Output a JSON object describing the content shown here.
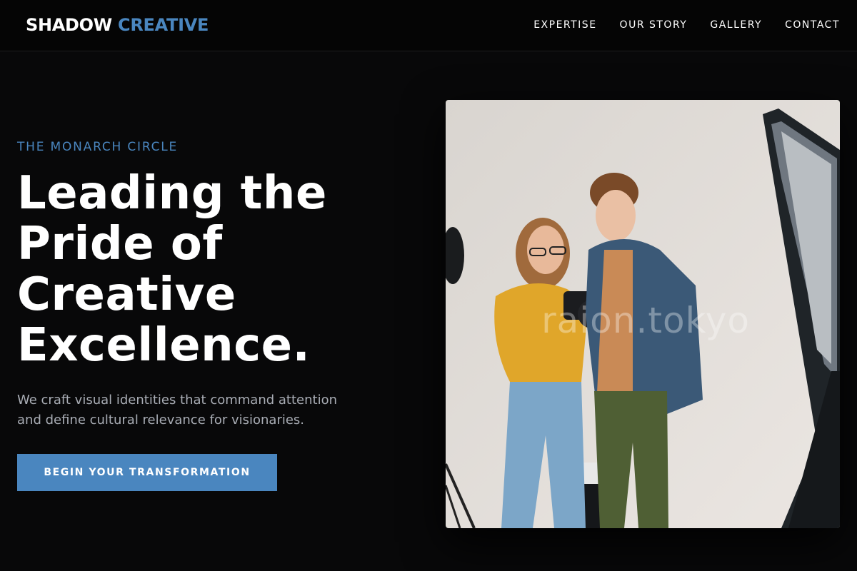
{
  "brand": {
    "name_part1": "SHADOW",
    "name_part2": "CREATIVE"
  },
  "nav": {
    "items": [
      "EXPERTISE",
      "OUR STORY",
      "GALLERY",
      "CONTACT"
    ]
  },
  "hero": {
    "eyebrow": "THE MONARCH CIRCLE",
    "headline_lines": [
      "Leading the",
      "Pride of",
      "Creative",
      "Excellence."
    ],
    "subtext_lines": [
      "We craft visual identities that command attention",
      "and define cultural relevance for visionaries."
    ],
    "cta_label": "BEGIN YOUR TRANSFORMATION",
    "image_watermark": "raion.tokyo"
  },
  "colors": {
    "accent": "#4a86bf",
    "background": "#080809",
    "header_background": "#050505",
    "subtext": "#a9adb5"
  }
}
